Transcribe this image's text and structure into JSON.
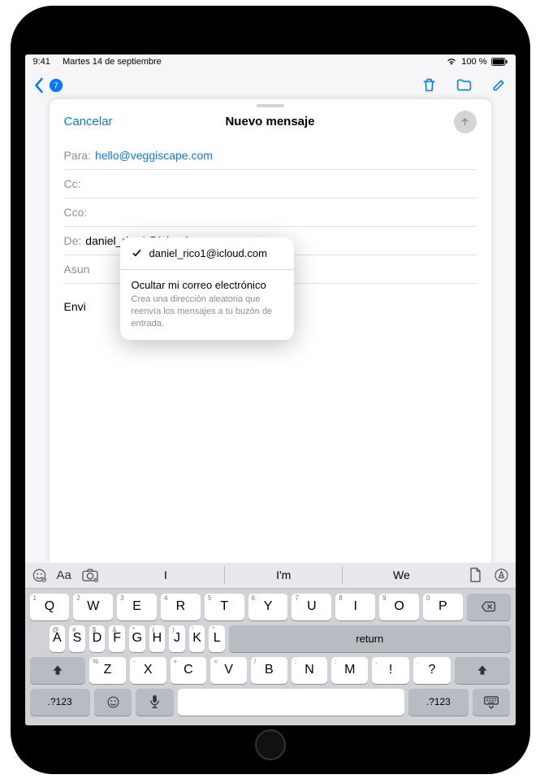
{
  "status": {
    "time": "9:41",
    "date": "Martes 14 de septiembre",
    "battery": "100 %"
  },
  "behind_toolbar": {
    "trash_label": "trash",
    "folder_label": "folder",
    "compose_label": "compose"
  },
  "compose": {
    "cancel": "Cancelar",
    "title": "Nuevo mensaje",
    "to_label": "Para:",
    "to_value": "hello@veggiscape.com",
    "cc_label": "Cc:",
    "cc_value": "",
    "bcc_label": "Cco:",
    "bcc_value": "",
    "from_label": "De:",
    "from_value": "daniel_rico1@icloud.com",
    "subject_label": "Asun",
    "subject_value": "",
    "body_prefix": "Envi"
  },
  "popover": {
    "selected_email": "daniel_rico1@icloud.com",
    "hide_title": "Ocultar mi correo electrónico",
    "hide_desc": "Crea una dirección aleatoria que reenvía los mensajes a tu buzón de entrada."
  },
  "keyboard": {
    "suggestions": [
      "I",
      "I'm",
      "We"
    ],
    "row1": [
      "Q",
      "W",
      "E",
      "R",
      "T",
      "Y",
      "U",
      "I",
      "O",
      "P"
    ],
    "row1_hints": [
      "1",
      "2",
      "3",
      "4",
      "5",
      "6",
      "7",
      "8",
      "9",
      "0"
    ],
    "row2": [
      "A",
      "S",
      "D",
      "F",
      "G",
      "H",
      "J",
      "K",
      "L"
    ],
    "row2_hints": [
      "@",
      "#",
      "$",
      "&",
      "*",
      "(",
      ")",
      "'",
      "\""
    ],
    "row3": [
      "Z",
      "X",
      "C",
      "V",
      "B",
      "N",
      "M"
    ],
    "row3_hints": [
      "%",
      "-",
      "+",
      "=",
      "/",
      ";",
      ":"
    ],
    "row3_punct": [
      "!",
      "?"
    ],
    "row3_punct_hints": [
      ",",
      "."
    ],
    "return": "return",
    "numkey": ".?123"
  }
}
